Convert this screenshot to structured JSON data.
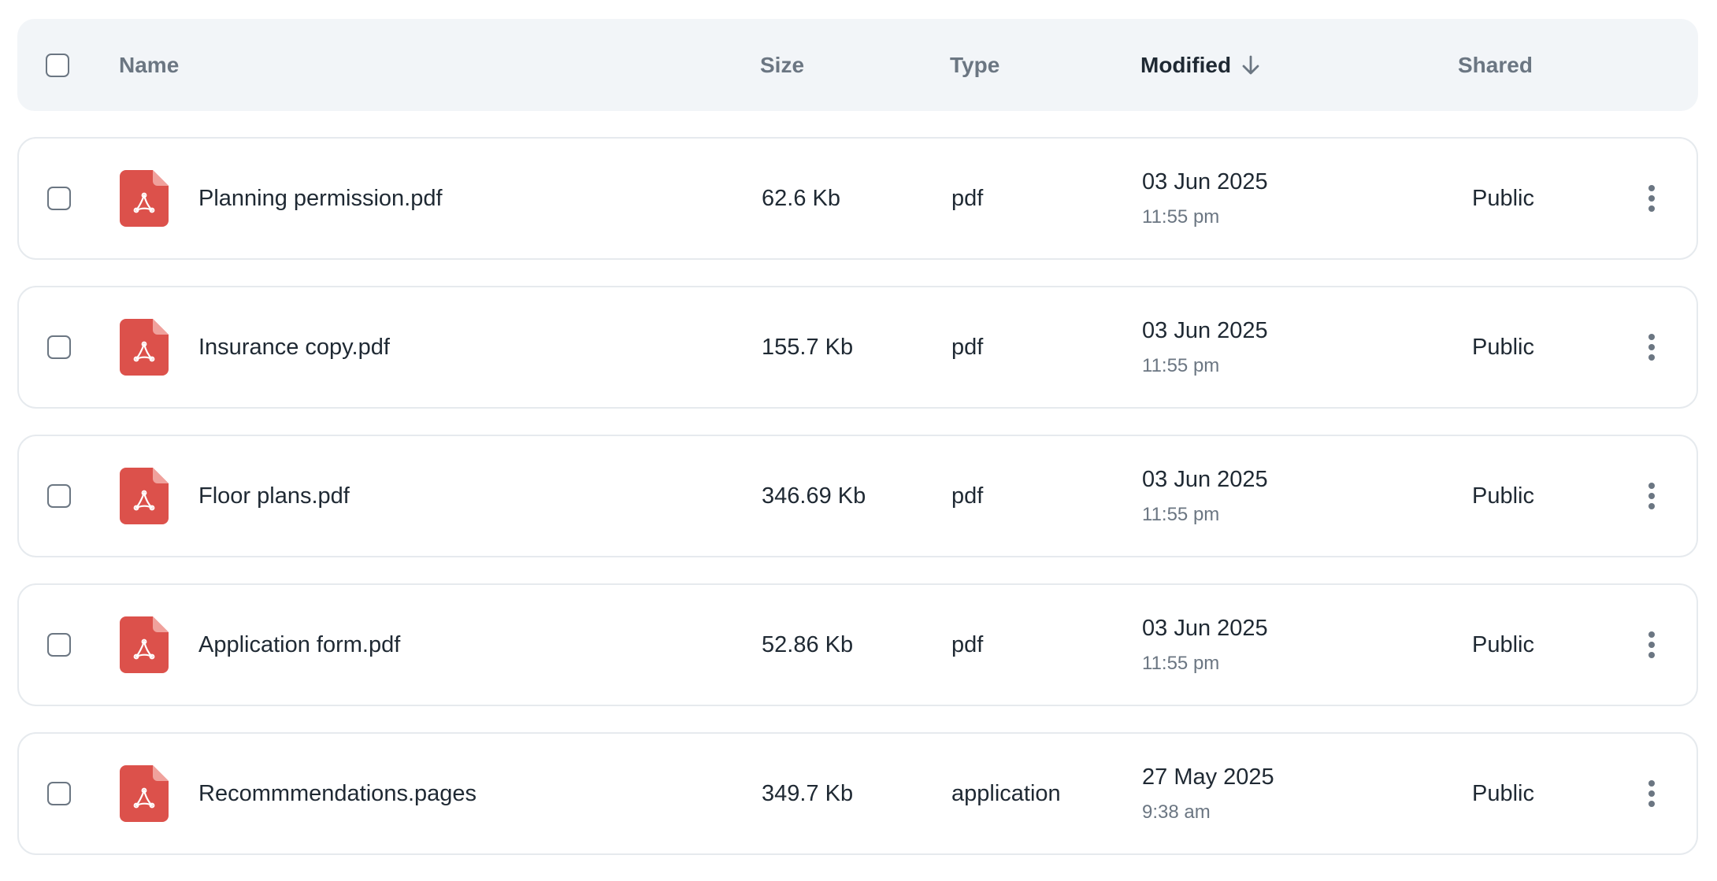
{
  "header": {
    "columns": {
      "name": "Name",
      "size": "Size",
      "type": "Type",
      "modified": "Modified",
      "shared": "Shared"
    },
    "sort_icon": "arrow-down-icon",
    "select_all_icon": "checkbox-empty-icon"
  },
  "files": [
    {
      "name": "Planning permission.pdf",
      "size": "62.6 Kb",
      "type": "pdf",
      "date": "03 Jun 2025",
      "time": "11:55 pm",
      "shared": "Public",
      "icon": "pdf-file-icon"
    },
    {
      "name": "Insurance copy.pdf",
      "size": "155.7 Kb",
      "type": "pdf",
      "date": "03 Jun 2025",
      "time": "11:55 pm",
      "shared": "Public",
      "icon": "pdf-file-icon"
    },
    {
      "name": "Floor plans.pdf",
      "size": "346.69 Kb",
      "type": "pdf",
      "date": "03 Jun 2025",
      "time": "11:55 pm",
      "shared": "Public",
      "icon": "pdf-file-icon"
    },
    {
      "name": "Application form.pdf",
      "size": "52.86 Kb",
      "type": "pdf",
      "date": "03 Jun 2025",
      "time": "11:55 pm",
      "shared": "Public",
      "icon": "pdf-file-icon"
    },
    {
      "name": "Recommmendations.pages",
      "size": "349.7 Kb",
      "type": "application",
      "date": "27 May 2025",
      "time": "9:38 am",
      "shared": "Public",
      "icon": "pdf-file-icon"
    }
  ],
  "colors": {
    "header_background": "#f2f5f8",
    "row_border": "#e6eaee",
    "primary_text": "#1f2933",
    "secondary_text": "#6b7682",
    "pdf_red": "#dc514b",
    "pdf_fold": "#f0a19c"
  }
}
